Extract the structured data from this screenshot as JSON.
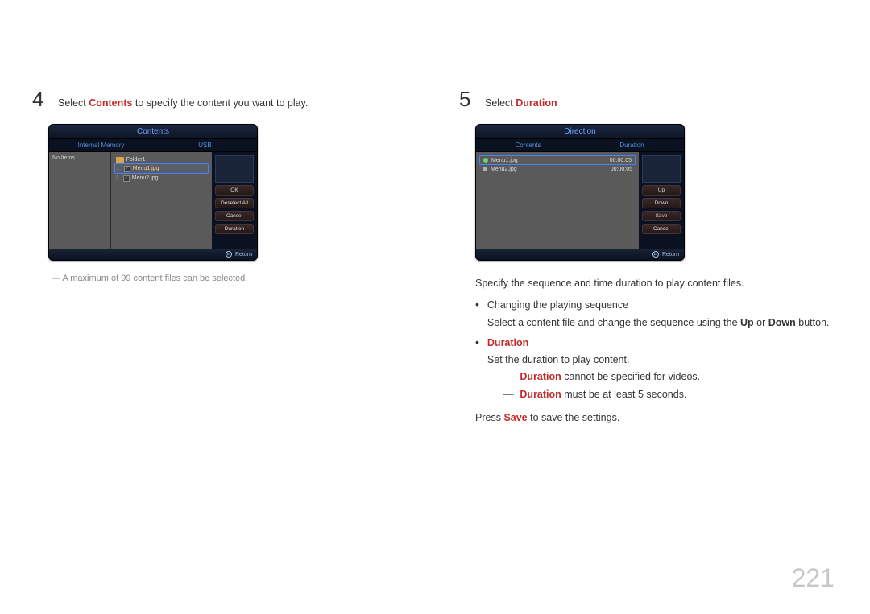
{
  "page_number": "221",
  "left": {
    "step_num": "4",
    "step_text_pre": "Select ",
    "step_text_hl": "Contents",
    "step_text_post": " to specify the content you want to play.",
    "shot": {
      "title": "Contents",
      "tab_left": "Internal Memory",
      "tab_right": "USB",
      "no_items": "No Items",
      "folder": "Folder1",
      "file1_idx": "1",
      "file1": "Menu1.jpg",
      "file2_idx": "2",
      "file2": "Menu2.jpg",
      "btn_ok": "OK",
      "btn_deselect": "Deselect All",
      "btn_cancel": "Cancel",
      "btn_duration": "Duration",
      "return": "Return"
    },
    "note": "A maximum of 99 content files can be selected."
  },
  "right": {
    "step_num": "5",
    "step_text_pre": "Select ",
    "step_text_hl": "Duration",
    "shot": {
      "title": "Direction",
      "tab_left": "Contents",
      "tab_right": "Duration",
      "row1_name": "Menu1.jpg",
      "row1_dur": "00:00:05",
      "row2_name": "Menu2.jpg",
      "row2_dur": "00:00:05",
      "btn_up": "Up",
      "btn_down": "Down",
      "btn_save": "Save",
      "btn_cancel": "Cancel",
      "return": "Return"
    },
    "intro": "Specify the sequence and time duration to play content files.",
    "b1_title": "Changing the playing sequence",
    "b1_line_pre": "Select a content file and change the sequence using the ",
    "b1_up": "Up",
    "b1_mid": " or ",
    "b1_down": "Down",
    "b1_post": " button.",
    "b2_title": "Duration",
    "b2_line": "Set the duration to play content.",
    "b2_sub1_hl": "Duration",
    "b2_sub1_post": " cannot be specified for videos.",
    "b2_sub2_hl": "Duration",
    "b2_sub2_post": " must be at least 5 seconds.",
    "press_pre": "Press ",
    "press_hl": "Save",
    "press_post": " to save the settings."
  }
}
